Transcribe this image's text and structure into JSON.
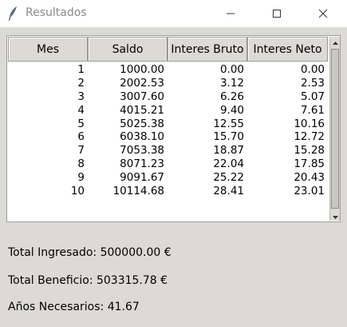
{
  "window": {
    "title": "Resultados",
    "feather_icon": "feather-icon",
    "buttons": {
      "minimize": "minimize-icon",
      "maximize": "maximize-icon",
      "close": "close-icon"
    }
  },
  "table": {
    "columns": [
      "Mes",
      "Saldo",
      "Interes Bruto",
      "Interes Neto"
    ],
    "rows": [
      [
        "1",
        "1000.00",
        "0.00",
        "0.00"
      ],
      [
        "2",
        "2002.53",
        "3.12",
        "2.53"
      ],
      [
        "3",
        "3007.60",
        "6.26",
        "5.07"
      ],
      [
        "4",
        "4015.21",
        "9.40",
        "7.61"
      ],
      [
        "5",
        "5025.38",
        "12.55",
        "10.16"
      ],
      [
        "6",
        "6038.10",
        "15.70",
        "12.72"
      ],
      [
        "7",
        "7053.38",
        "18.87",
        "15.28"
      ],
      [
        "8",
        "8071.23",
        "22.04",
        "17.85"
      ],
      [
        "9",
        "9091.67",
        "25.22",
        "20.43"
      ],
      [
        "10",
        "10114.68",
        "28.41",
        "23.01"
      ]
    ]
  },
  "summary": {
    "total_ingresado": "Total Ingresado: 500000.00 €",
    "total_beneficio": "Total Beneficio: 503315.78 €",
    "anos_necesarios": "Años Necesarios: 41.67"
  }
}
